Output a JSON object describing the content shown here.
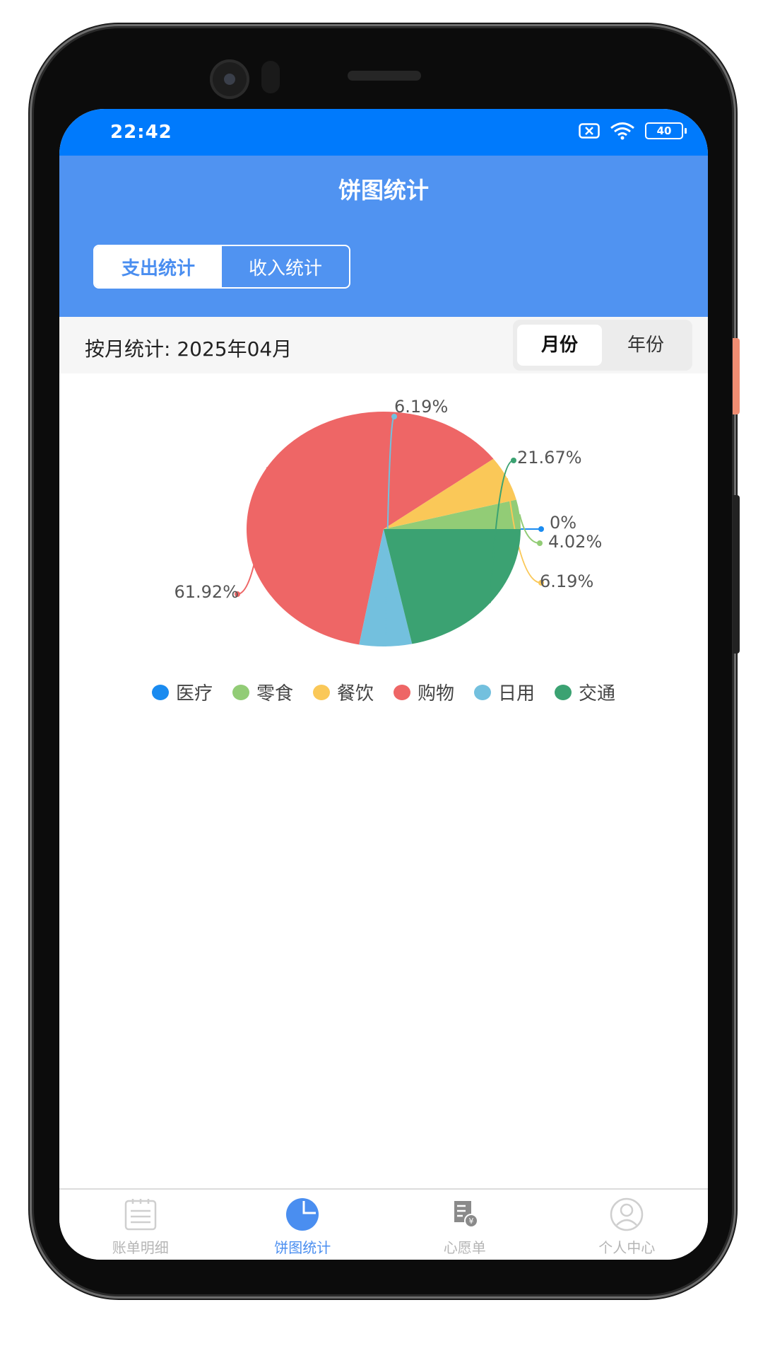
{
  "status_bar": {
    "time": "22:42",
    "battery": "40"
  },
  "header": {
    "title": "饼图统计"
  },
  "segment": {
    "expense_label": "支出统计",
    "income_label": "收入统计",
    "selected": "expense"
  },
  "filter": {
    "label": "按月统计: 2025年04月",
    "month_label": "月份",
    "year_label": "年份",
    "selected": "month"
  },
  "chart_data": {
    "type": "pie",
    "series": [
      {
        "name": "医疗",
        "value": 0.0,
        "label": "0%",
        "color": "#1a8bf0"
      },
      {
        "name": "零食",
        "value": 4.02,
        "label": "4.02%",
        "color": "#92cc76"
      },
      {
        "name": "餐饮",
        "value": 6.19,
        "label": "6.19%",
        "color": "#fac858"
      },
      {
        "name": "购物",
        "value": 61.92,
        "label": "61.92%",
        "color": "#ee6666"
      },
      {
        "name": "日用",
        "value": 6.19,
        "label": "6.19%",
        "color": "#73c0de"
      },
      {
        "name": "交通",
        "value": 21.67,
        "label": "21.67%",
        "color": "#3ba272"
      }
    ],
    "legend_position": "bottom"
  },
  "tabs": [
    {
      "label": "账单明细",
      "icon": "list-icon",
      "active": false
    },
    {
      "label": "饼图统计",
      "icon": "pie-chart-icon",
      "active": true
    },
    {
      "label": "心愿单",
      "icon": "wish-receipt-icon",
      "active": false
    },
    {
      "label": "个人中心",
      "icon": "user-icon",
      "active": false
    }
  ]
}
